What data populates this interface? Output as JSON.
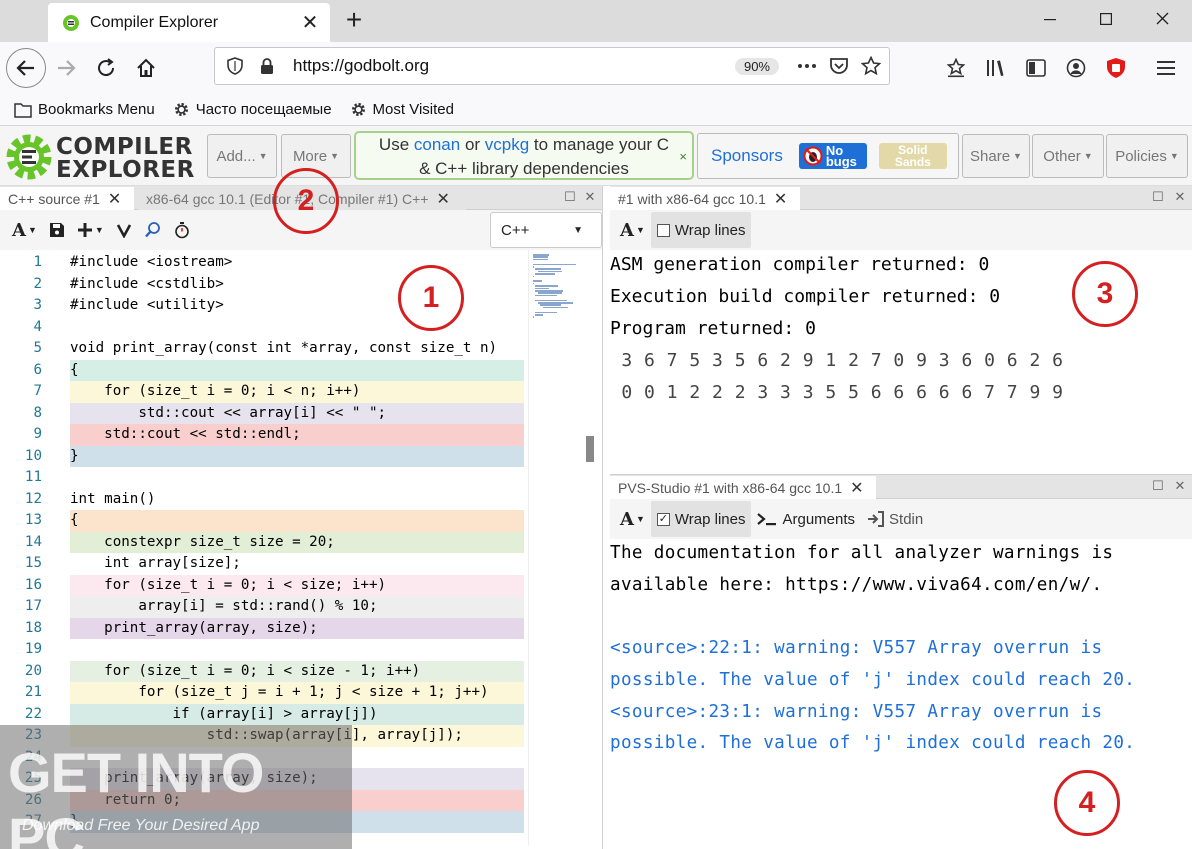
{
  "browser": {
    "tab_title": "Compiler Explorer",
    "tab_close": "✕",
    "new_tab": "+",
    "url": "https://godbolt.org",
    "zoom": "90%",
    "bookmarks": [
      "Bookmarks Menu",
      "Часто посещаемые",
      "Most Visited"
    ]
  },
  "header": {
    "logo_line1": "COMPILER",
    "logo_line2": "EXPLORER",
    "add_label": "Add...",
    "more_label": "More",
    "promo_pre": "Use ",
    "promo_conan": "conan",
    "promo_or": " or ",
    "promo_vcpkg": "vcpkg",
    "promo_post": " to manage your C",
    "promo_line2": "& C++ library dependencies",
    "promo_close": "×",
    "sponsors_label": "Sponsors",
    "nobugs_1": "No",
    "nobugs_2": "bugs",
    "solid_1": "Solid",
    "solid_2": "Sands",
    "share_label": "Share",
    "other_label": "Other",
    "policies_label": "Policies"
  },
  "editor": {
    "tabs": [
      "C++ source #1",
      "x86-64 gcc 10.1 (Editor #1, Compiler #1) C++"
    ],
    "language": "C++",
    "lines": [
      {
        "n": "1",
        "t": "#include <iostream>",
        "bg": "#ffffff"
      },
      {
        "n": "2",
        "t": "#include <cstdlib>",
        "bg": "#ffffff"
      },
      {
        "n": "3",
        "t": "#include <utility>",
        "bg": "#ffffff"
      },
      {
        "n": "4",
        "t": "",
        "bg": "#ffffff"
      },
      {
        "n": "5",
        "t": "void print_array(const int *array, const size_t n)",
        "bg": "#ffffff"
      },
      {
        "n": "6",
        "t": "{",
        "bg": "#d6efe6"
      },
      {
        "n": "7",
        "t": "    for (size_t i = 0; i < n; i++)",
        "bg": "#fbf7d8"
      },
      {
        "n": "8",
        "t": "        std::cout << array[i] << \" \";",
        "bg": "#e6e2ee"
      },
      {
        "n": "9",
        "t": "    std::cout << std::endl;",
        "bg": "#f8cfcd"
      },
      {
        "n": "10",
        "t": "}",
        "bg": "#cfe0ea"
      },
      {
        "n": "11",
        "t": "",
        "bg": "#ffffff"
      },
      {
        "n": "12",
        "t": "int main()",
        "bg": "#ffffff"
      },
      {
        "n": "13",
        "t": "{",
        "bg": "#fce3cc"
      },
      {
        "n": "14",
        "t": "    constexpr size_t size = 20;",
        "bg": "#e2efd6"
      },
      {
        "n": "15",
        "t": "    int array[size];",
        "bg": "#ffffff"
      },
      {
        "n": "16",
        "t": "    for (size_t i = 0; i < size; i++)",
        "bg": "#fce8ef"
      },
      {
        "n": "17",
        "t": "        array[i] = std::rand() % 10;",
        "bg": "#eeeeee"
      },
      {
        "n": "18",
        "t": "    print_array(array, size);",
        "bg": "#e6d6ea"
      },
      {
        "n": "19",
        "t": "",
        "bg": "#ffffff"
      },
      {
        "n": "20",
        "t": "    for (size_t i = 0; i < size - 1; i++)",
        "bg": "#e6f0e2"
      },
      {
        "n": "21",
        "t": "        for (size_t j = i + 1; j < size + 1; j++)",
        "bg": "#fbf7d8"
      },
      {
        "n": "22",
        "t": "            if (array[i] > array[j])",
        "bg": "#d7ebe6"
      },
      {
        "n": "23",
        "t": "                std::swap(array[i], array[j]);",
        "bg": "#fbf7d8"
      },
      {
        "n": "24",
        "t": "",
        "bg": "#ffffff"
      },
      {
        "n": "25",
        "t": "    print_array(array, size);",
        "bg": "#e6e2ee"
      },
      {
        "n": "26",
        "t": "    return 0;",
        "bg": "#f8cfcd"
      },
      {
        "n": "27",
        "t": "}",
        "bg": "#cfe0ea"
      }
    ]
  },
  "exec_pane": {
    "tab": "#1 with x86-64 gcc 10.1",
    "wrap_label": "Wrap lines",
    "lines": [
      "ASM generation compiler returned: 0",
      "Execution build compiler returned: 0",
      "Program returned: 0",
      " 3 6 7 5 3 5 6 2 9 1 2 7 0 9 3 6 0 6 2 6",
      " 0 0 1 2 2 2 3 3 3 5 5 6 6 6 6 6 7 7 9 9"
    ]
  },
  "pvs_pane": {
    "tab": "PVS-Studio #1 with x86-64 gcc 10.1",
    "wrap_label": "Wrap lines",
    "args_label": "Arguments",
    "stdin_label": "Stdin",
    "lines": [
      {
        "t": "The documentation for all analyzer warnings is",
        "c": "#000000"
      },
      {
        "t": "available here: https://www.viva64.com/en/w/.",
        "c": "#000000"
      },
      {
        "t": "",
        "c": "#000000"
      },
      {
        "t": "<source>:22:1: warning: V557 Array overrun is",
        "c": "#1e6fd9"
      },
      {
        "t": "possible. The value of 'j' index could reach 20.",
        "c": "#1e6fd9"
      },
      {
        "t": "<source>:23:1: warning: V557 Array overrun is",
        "c": "#1e6fd9"
      },
      {
        "t": "possible. The value of 'j' index could reach 20.",
        "c": "#1e6fd9"
      }
    ]
  },
  "watermark": {
    "line1": "GET INTO PC",
    "line2": "Download Free Your Desired App"
  },
  "annotations": [
    "1",
    "2",
    "3",
    "4"
  ],
  "colors": {
    "accent": "#1e6fd9",
    "annotation": "#d42020",
    "promo_border": "#a6d18a"
  }
}
